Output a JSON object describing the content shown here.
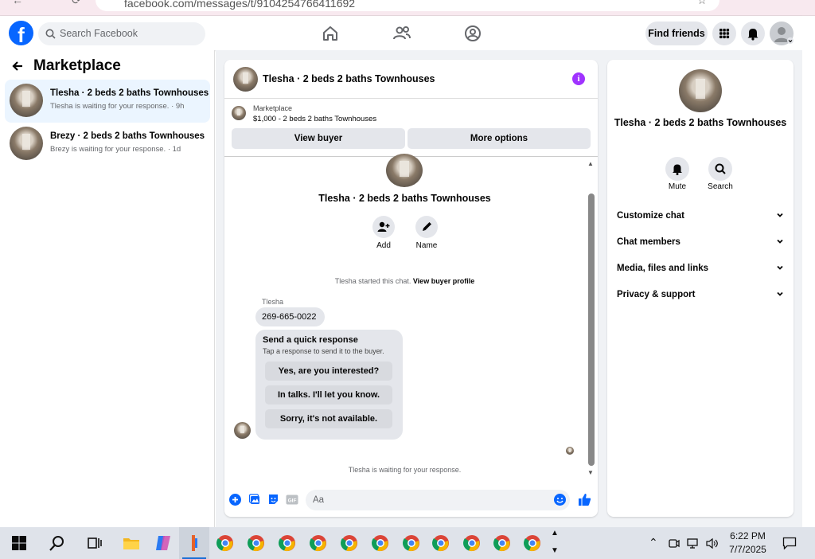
{
  "browser": {
    "url": "facebook.com/messages/t/9104254766411692"
  },
  "header": {
    "logo": "f",
    "search_placeholder": "Search Facebook",
    "find_friends": "Find friends"
  },
  "sidebar": {
    "title": "Marketplace",
    "conversations": [
      {
        "title": "Tlesha · 2 beds 2 baths Townhouses",
        "snippet": "Tlesha is waiting for your response. · 9h"
      },
      {
        "title": "Brezy · 2 beds 2 baths Townhouses",
        "snippet": "Brezy is waiting for your response. · 1d"
      }
    ]
  },
  "chat": {
    "title": "Tlesha · 2 beds 2 baths Townhouses",
    "listing_label": "Marketplace",
    "listing_price_title": "$1,000 - 2 beds 2 baths Townhouses",
    "view_buyer": "View buyer",
    "more_options": "More options",
    "intro_title": "Tlesha · 2 beds 2 baths Townhouses",
    "add_label": "Add",
    "name_label": "Name",
    "started_text": "Tlesha started this chat.",
    "view_profile": "View buyer profile",
    "sender": "Tlesha",
    "message": "269-665-0022",
    "quick_title": "Send a quick response",
    "quick_sub": "Tap a response to send it to the buyer.",
    "quick_replies": [
      "Yes, are you interested?",
      "In talks. I'll let you know.",
      "Sorry, it's not available."
    ],
    "waiting": "Tlesha is waiting for your response.",
    "composer_placeholder": "Aa"
  },
  "details": {
    "title": "Tlesha · 2 beds 2 baths Townhouses",
    "mute": "Mute",
    "search": "Search",
    "sections": [
      "Customize chat",
      "Chat members",
      "Media, files and links",
      "Privacy & support"
    ]
  },
  "taskbar": {
    "time": "6:22 PM",
    "date": "7/7/2025"
  },
  "colors": {
    "brand": "#0866ff",
    "info": "#a033ff",
    "bubble": "#e4e6eb",
    "selected": "#ebf5ff"
  }
}
